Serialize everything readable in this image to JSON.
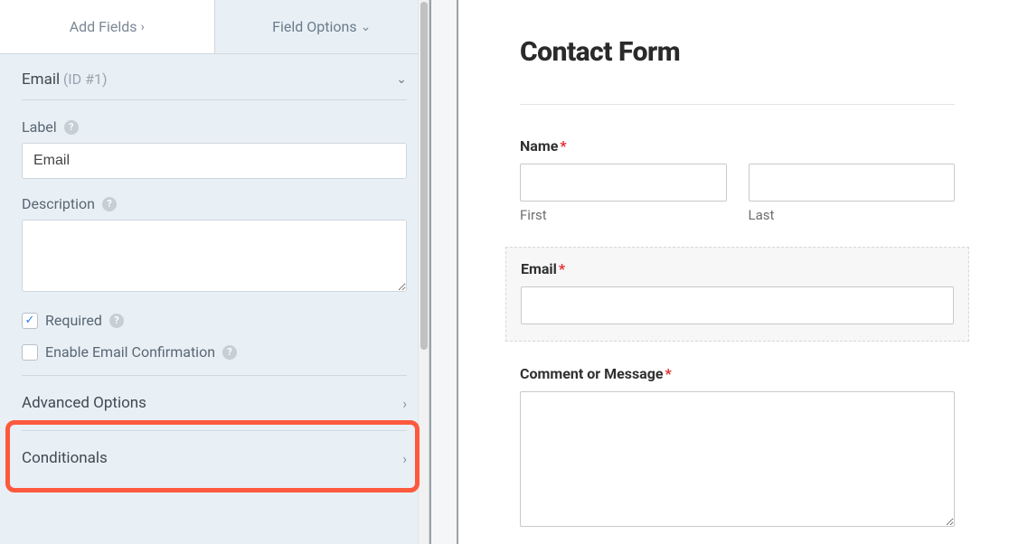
{
  "sidebar": {
    "tabs": {
      "add_fields": "Add Fields",
      "field_options": "Field Options"
    },
    "field": {
      "name": "Email",
      "id": "(ID #1)"
    },
    "label": {
      "title": "Label",
      "value": "Email"
    },
    "description": {
      "title": "Description",
      "value": ""
    },
    "required": {
      "label": "Required",
      "checked": true
    },
    "email_confirmation": {
      "label": "Enable Email Confirmation",
      "checked": false
    },
    "sections": {
      "advanced": "Advanced Options",
      "conditionals": "Conditionals"
    }
  },
  "preview": {
    "title": "Contact Form",
    "name": {
      "label": "Name",
      "first_sub": "First",
      "last_sub": "Last"
    },
    "email": {
      "label": "Email"
    },
    "comment": {
      "label": "Comment or Message"
    },
    "required_mark": "*"
  }
}
